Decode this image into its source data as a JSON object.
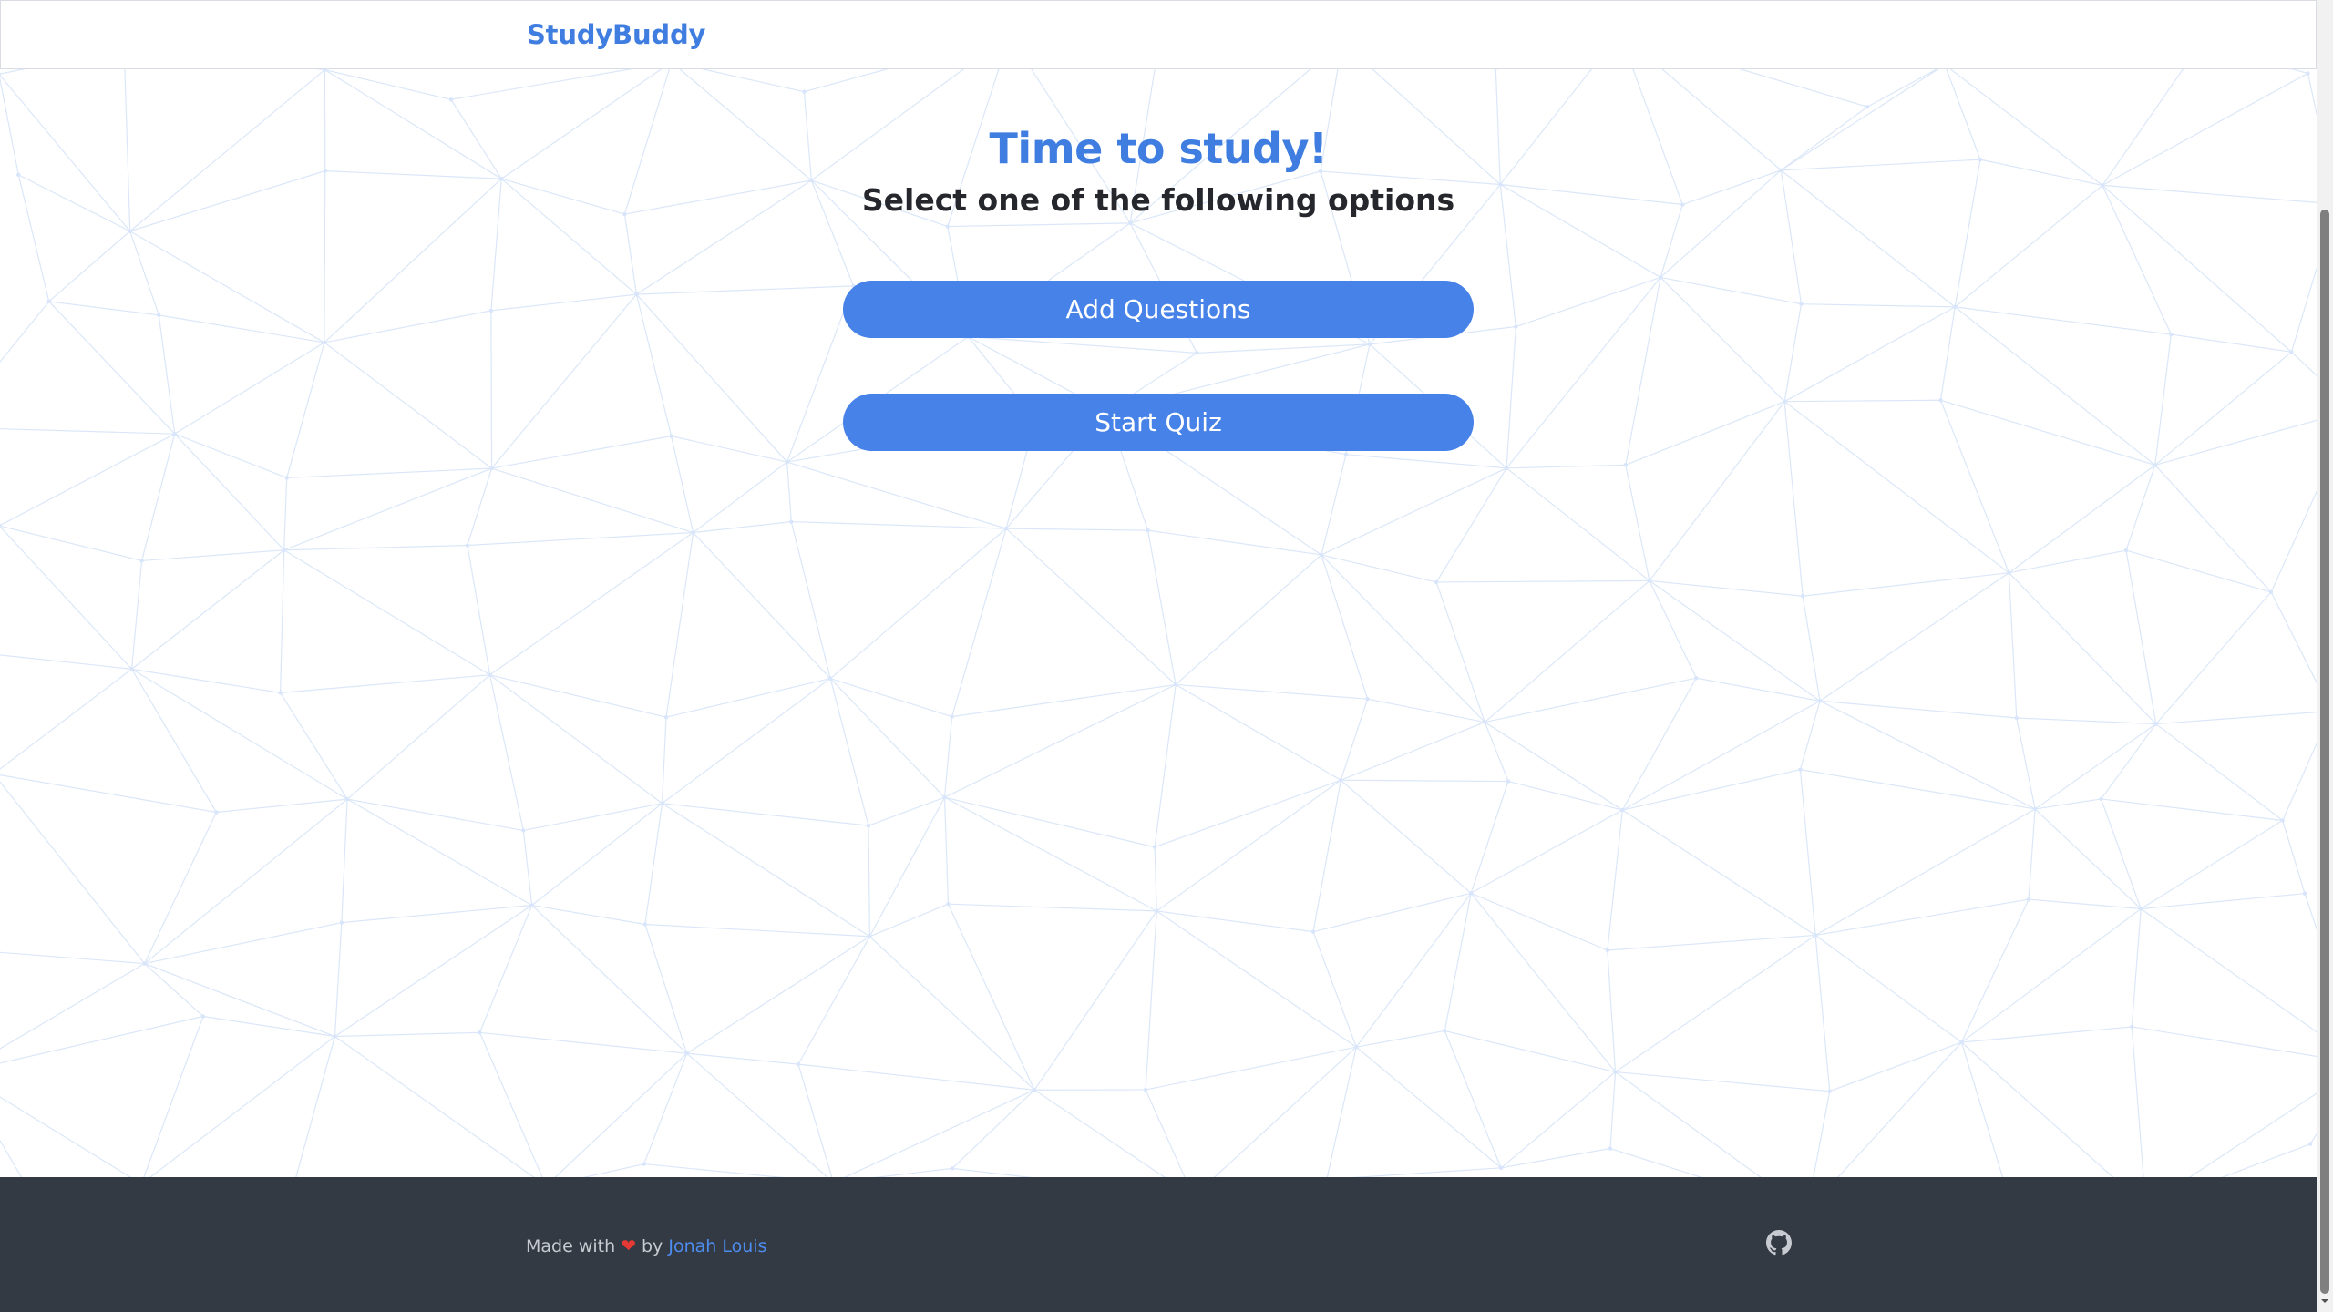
{
  "app": {
    "brand": "StudyBuddy"
  },
  "main": {
    "title": "Time to study!",
    "subtitle": "Select one of the following options",
    "actions": [
      {
        "label": "Add Questions"
      },
      {
        "label": "Start Quiz"
      }
    ]
  },
  "footer": {
    "made_with_prefix": "Made with",
    "by_label": "by",
    "author_name": "Jonah Louis"
  },
  "icons": {
    "heart": "heart-icon",
    "github": "github-icon",
    "scroll_down": "chevron-down-icon"
  },
  "colors": {
    "accent": "#3f7ee0",
    "button": "#4682e8",
    "footer_bg": "#343a43",
    "heart": "#e53935",
    "text_dark": "#25272d"
  }
}
